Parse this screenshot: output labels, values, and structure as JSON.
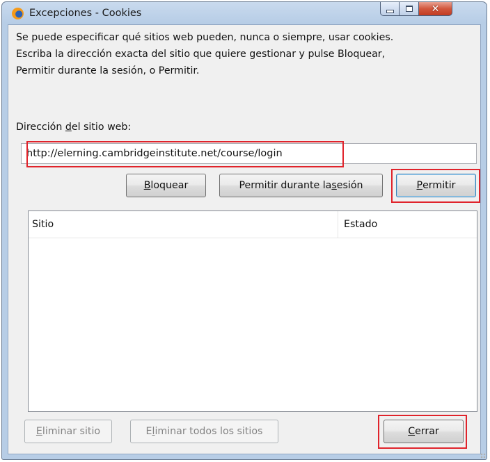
{
  "window": {
    "title": "Excepciones - Cookies",
    "controls": {
      "minimize": "minimize-icon",
      "maximize": "maximize-icon",
      "close": "close-icon"
    }
  },
  "description": {
    "line1": "Se puede especificar qué sitios web pueden, nunca o siempre, usar cookies.",
    "line2": "Escriba la dirección exacta del sitio que quiere gestionar y pulse Bloquear,",
    "line3": "Permitir durante la sesión, o Permitir."
  },
  "address": {
    "label_pre": "Dirección ",
    "label_accel": "d",
    "label_post": "el sitio web:",
    "value": "http://elerning.cambridgeinstitute.net/course/login"
  },
  "buttons": {
    "block": {
      "accel": "B",
      "rest": "loquear"
    },
    "allow_session": {
      "pre": "Permitir durante la ",
      "accel": "s",
      "post": "esión"
    },
    "allow": {
      "accel": "P",
      "rest": "ermitir"
    },
    "remove_site": {
      "accel": "E",
      "rest": "liminar sitio"
    },
    "remove_all": {
      "pre": "E",
      "accel": "l",
      "post": "iminar todos los sitios"
    },
    "close": {
      "accel": "C",
      "rest": "errar"
    }
  },
  "table": {
    "columns": [
      "Sitio",
      "Estado"
    ],
    "rows": []
  },
  "colors": {
    "highlight": "#e0232b",
    "window_frame": "#b7cde6",
    "client_bg": "#f0f0f0"
  }
}
